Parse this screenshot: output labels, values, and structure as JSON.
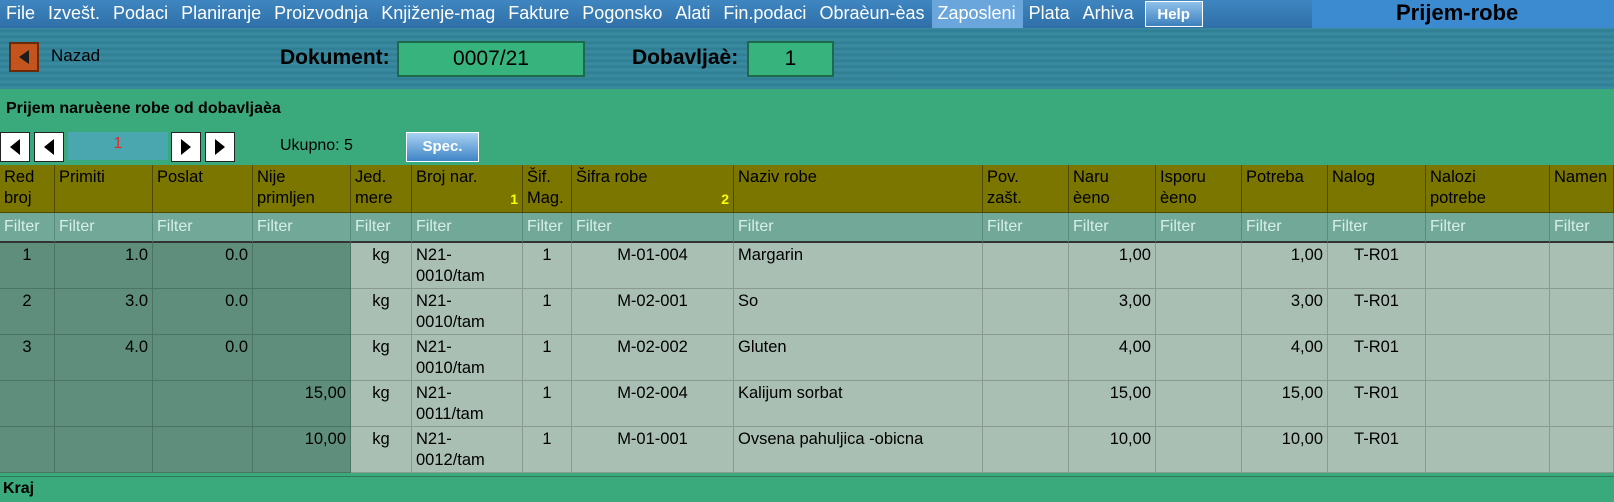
{
  "menu": {
    "items": [
      "File",
      "Izvešt.",
      "Podaci",
      "Planiranje",
      "Proizvodnja",
      "Knjiženje-mag",
      "Fakture",
      "Pogonsko",
      "Alati",
      "Fin.podaci",
      "Obraèun-èas",
      "Zaposleni",
      "Plata",
      "Arhiva"
    ],
    "active_index": 11,
    "help_label": "Help",
    "app_title": "Prijem-robe"
  },
  "header": {
    "back_label": "Nazad",
    "document_label": "Dokument:",
    "document_value": "0007/21",
    "supplier_label": "Dobavljaè:",
    "supplier_value": "1"
  },
  "section": {
    "title": "Prijem naruèene robe od dobavljaèa"
  },
  "pager": {
    "page_value": "1",
    "total_label": "Ukupno: 5",
    "spec_label": "Spec."
  },
  "table": {
    "columns": [
      {
        "line1": "Red",
        "line2": "broj",
        "mark": ""
      },
      {
        "line1": "Primiti",
        "line2": "",
        "mark": ""
      },
      {
        "line1": "Poslat",
        "line2": "",
        "mark": ""
      },
      {
        "line1": "Nije",
        "line2": "primljen",
        "mark": ""
      },
      {
        "line1": "Jed.",
        "line2": "mere",
        "mark": ""
      },
      {
        "line1": "Broj nar.",
        "line2": "",
        "mark": "1"
      },
      {
        "line1": "Šif.",
        "line2": "Mag.",
        "mark": ""
      },
      {
        "line1": "Šifra robe",
        "line2": "",
        "mark": "2"
      },
      {
        "line1": "Naziv robe",
        "line2": "",
        "mark": ""
      },
      {
        "line1": "Pov.",
        "line2": "zašt.",
        "mark": ""
      },
      {
        "line1": "Naru",
        "line2": "èeno",
        "mark": ""
      },
      {
        "line1": "Isporu",
        "line2": "èeno",
        "mark": ""
      },
      {
        "line1": "Potreba",
        "line2": "",
        "mark": ""
      },
      {
        "line1": "Nalog",
        "line2": "",
        "mark": ""
      },
      {
        "line1": "Nalozi",
        "line2": "potrebe",
        "mark": ""
      },
      {
        "line1": "Namen",
        "line2": "",
        "mark": ""
      }
    ],
    "filter_placeholder": "Filter",
    "rows": [
      [
        "1",
        "1.0",
        "0.0",
        "",
        "kg",
        "N21-0010/tam",
        "1",
        "M-01-004",
        "Margarin",
        "",
        "1,00",
        "",
        "1,00",
        "T-R01",
        "",
        ""
      ],
      [
        "2",
        "3.0",
        "0.0",
        "",
        "kg",
        "N21-0010/tam",
        "1",
        "M-02-001",
        "So",
        "",
        "3,00",
        "",
        "3,00",
        "T-R01",
        "",
        ""
      ],
      [
        "3",
        "4.0",
        "0.0",
        "",
        "kg",
        "N21-0010/tam",
        "1",
        "M-02-002",
        "Gluten",
        "",
        "4,00",
        "",
        "4,00",
        "T-R01",
        "",
        ""
      ],
      [
        "",
        "",
        "",
        "15,00",
        "kg",
        "N21-0011/tam",
        "1",
        "M-02-004",
        "Kalijum sorbat",
        "",
        "15,00",
        "",
        "15,00",
        "T-R01",
        "",
        ""
      ],
      [
        "",
        "",
        "",
        "10,00",
        "kg",
        "N21-0012/tam",
        "1",
        "M-01-001",
        "Ovsena pahuljica -obicna",
        "",
        "10,00",
        "",
        "10,00",
        "T-R01",
        "",
        ""
      ]
    ]
  },
  "footer": {
    "label": "Kraj"
  }
}
